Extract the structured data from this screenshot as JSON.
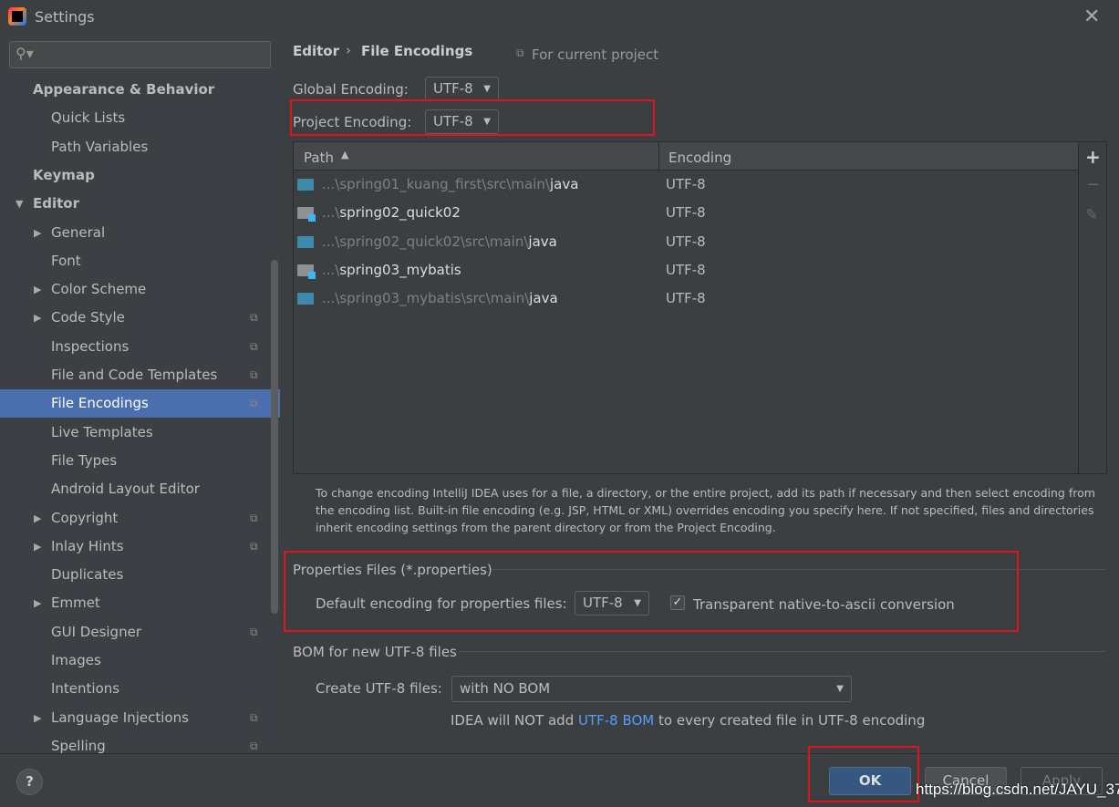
{
  "window": {
    "title": "Settings",
    "close": "✕"
  },
  "search": {
    "icon": "search-icon",
    "placeholder": ""
  },
  "sidebar": {
    "items": [
      {
        "label": "Appearance & Behavior",
        "level": 0,
        "bold": true
      },
      {
        "label": "Quick Lists",
        "level": 1
      },
      {
        "label": "Path Variables",
        "level": 1
      },
      {
        "label": "Keymap",
        "level": 0,
        "bold": true
      },
      {
        "label": "Editor",
        "level": 0,
        "bold": true,
        "expanded": true
      },
      {
        "label": "General",
        "level": 1,
        "arrow": true
      },
      {
        "label": "Font",
        "level": 1
      },
      {
        "label": "Color Scheme",
        "level": 1,
        "arrow": true
      },
      {
        "label": "Code Style",
        "level": 1,
        "arrow": true,
        "copy": true
      },
      {
        "label": "Inspections",
        "level": 1,
        "copy": true
      },
      {
        "label": "File and Code Templates",
        "level": 1,
        "copy": true
      },
      {
        "label": "File Encodings",
        "level": 1,
        "copy": true,
        "selected": true
      },
      {
        "label": "Live Templates",
        "level": 1
      },
      {
        "label": "File Types",
        "level": 1
      },
      {
        "label": "Android Layout Editor",
        "level": 1
      },
      {
        "label": "Copyright",
        "level": 1,
        "arrow": true,
        "copy": true
      },
      {
        "label": "Inlay Hints",
        "level": 1,
        "arrow": true,
        "copy": true
      },
      {
        "label": "Duplicates",
        "level": 1
      },
      {
        "label": "Emmet",
        "level": 1,
        "arrow": true
      },
      {
        "label": "GUI Designer",
        "level": 1,
        "copy": true
      },
      {
        "label": "Images",
        "level": 1
      },
      {
        "label": "Intentions",
        "level": 1
      },
      {
        "label": "Language Injections",
        "level": 1,
        "arrow": true,
        "copy": true
      },
      {
        "label": "Spelling",
        "level": 1,
        "copy": true
      }
    ]
  },
  "breadcrumb": {
    "parent": "Editor",
    "sep": "›",
    "current": "File Encodings",
    "scope": "For current project"
  },
  "global_encoding": {
    "label": "Global Encoding:",
    "value": "UTF-8"
  },
  "project_encoding": {
    "label": "Project Encoding:",
    "value": "UTF-8"
  },
  "table": {
    "headers": {
      "path": "Path",
      "sort": "▲",
      "encoding": "Encoding"
    },
    "rows": [
      {
        "prefix": "...\\spring01_kuang_first\\src\\main\\",
        "name": "java",
        "encoding": "UTF-8",
        "type": "source-folder"
      },
      {
        "prefix": "...\\",
        "name": "spring02_quick02",
        "encoding": "UTF-8",
        "type": "module"
      },
      {
        "prefix": "...\\spring02_quick02\\src\\main\\",
        "name": "java",
        "encoding": "UTF-8",
        "type": "source-folder"
      },
      {
        "prefix": "...\\",
        "name": "spring03_mybatis",
        "encoding": "UTF-8",
        "type": "module"
      },
      {
        "prefix": "...\\spring03_mybatis\\src\\main\\",
        "name": "java",
        "encoding": "UTF-8",
        "type": "source-folder"
      }
    ],
    "tools": {
      "add": "+",
      "remove": "−",
      "edit": "✎"
    }
  },
  "hint": "To change encoding IntelliJ IDEA uses for a file, a directory, or the entire project, add its path if necessary and then select encoding from the encoding list. Built-in file encoding (e.g. JSP, HTML or XML) overrides encoding you specify here. If not specified, files and directories inherit encoding settings from the parent directory or from the Project Encoding.",
  "properties": {
    "title": "Properties Files (*.properties)",
    "label": "Default encoding for properties files:",
    "value": "UTF-8",
    "checkbox_label": "Transparent native-to-ascii conversion",
    "checked": true
  },
  "bom": {
    "title": "BOM for new UTF-8 files",
    "label": "Create UTF-8 files:",
    "value": "with NO BOM",
    "note_pre": "IDEA will NOT add ",
    "note_link": "UTF-8 BOM",
    "note_post": " to every created file in UTF-8 encoding"
  },
  "footer": {
    "help": "?",
    "ok": "OK",
    "cancel": "Cancel",
    "apply": "Apply"
  },
  "watermark": "https://blog.csdn.net/JAYU_37",
  "colors": {
    "accent": "#4b6eaf",
    "ok": "#365880",
    "link": "#589df6",
    "annotation": "#e0141e"
  }
}
